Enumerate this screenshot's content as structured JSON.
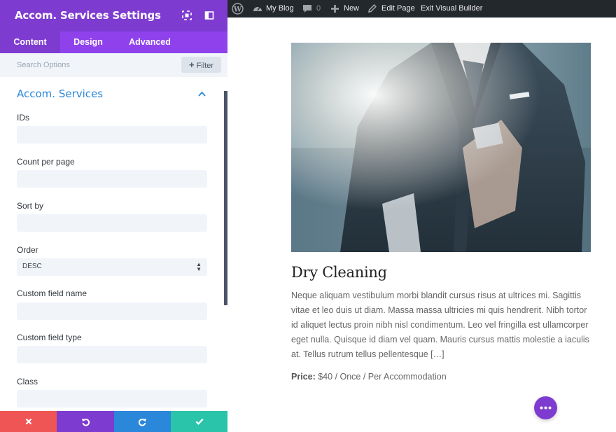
{
  "panel": {
    "title": "Accom. Services Settings",
    "tabs": [
      {
        "label": "Content",
        "active": true
      },
      {
        "label": "Design",
        "active": false
      },
      {
        "label": "Advanced",
        "active": false
      }
    ],
    "search": {
      "placeholder": "Search Options"
    },
    "filter_label": "Filter",
    "section_title": "Accom. Services",
    "fields": [
      {
        "label": "IDs",
        "value": ""
      },
      {
        "label": "Count per page",
        "value": ""
      },
      {
        "label": "Sort by",
        "value": ""
      },
      {
        "label": "Order",
        "value": "DESC"
      },
      {
        "label": "Custom field name",
        "value": ""
      },
      {
        "label": "Custom field type",
        "value": ""
      },
      {
        "label": "Class",
        "value": ""
      }
    ]
  },
  "admin_bar": {
    "site_name": "My Blog",
    "comments_count": "0",
    "new_label": "New",
    "edit_page_label": "Edit Page",
    "exit_label": "Exit Visual Builder"
  },
  "service": {
    "title": "Dry Cleaning",
    "description": "Neque aliquam vestibulum morbi blandit cursus risus at ultrices mi. Sagittis vitae et leo duis ut diam. Massa massa ultricies mi quis hendrerit. Nibh tortor id aliquet lectus proin nibh nisl condimentum. Leo vel fringilla est ullamcorper eget nulla. Quisque id diam vel quam. Mauris cursus mattis molestie a iaculis at. Tellus rutrum tellus pellentesque […]",
    "price_label": "Price:",
    "price_value": "$40 / Once / Per Accommodation"
  },
  "colors": {
    "accent_purple": "#7e3bd0",
    "tab_bar": "#8f42ec",
    "link_blue": "#2b87da",
    "discard_red": "#ef5555",
    "save_green": "#29c4a9",
    "admin_bar": "#23282d"
  },
  "icons": {
    "header": [
      "expand-icon",
      "sidebar-icon"
    ],
    "bottom_bar": [
      "close-icon",
      "undo-icon",
      "redo-icon",
      "check-icon"
    ],
    "admin_bar": [
      "wordpress-icon",
      "dashboard-icon",
      "comment-icon",
      "plus-icon",
      "pencil-icon"
    ],
    "floating": "ellipsis-icon"
  }
}
